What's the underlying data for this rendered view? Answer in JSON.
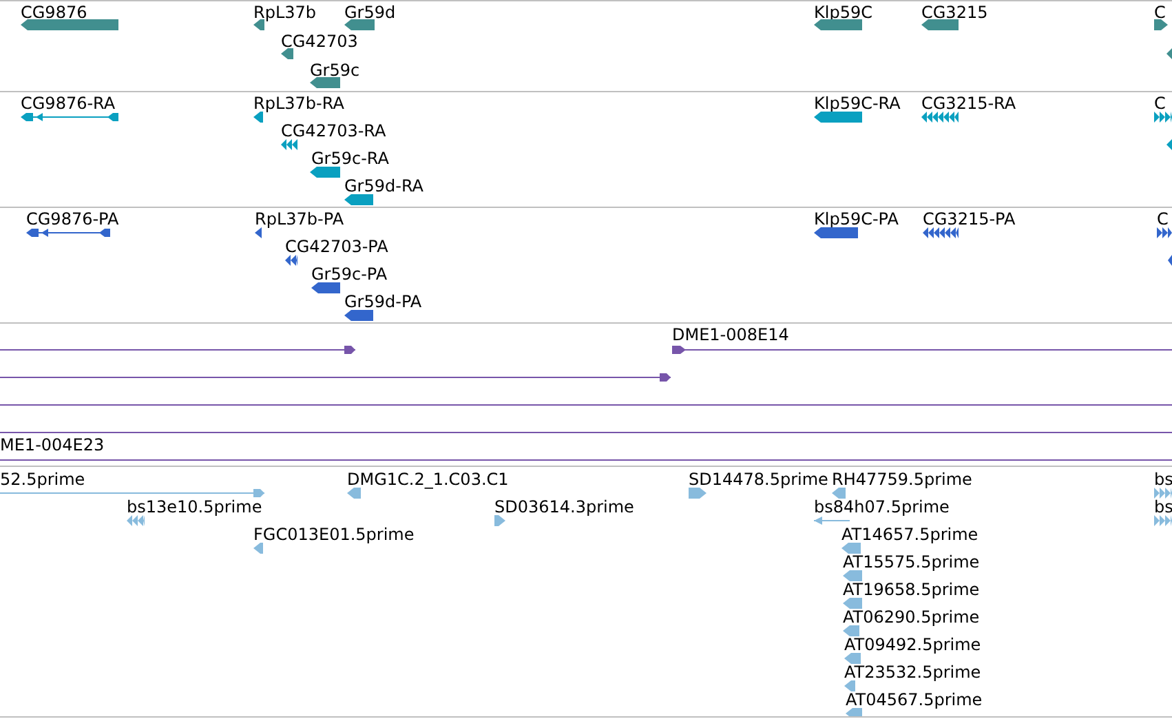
{
  "tracks": [
    {
      "color": "#418f8f",
      "features": [
        {
          "label": "CG9876",
          "reverse": true,
          "kind": "block"
        },
        {
          "label": "RpL37b",
          "reverse": true,
          "kind": "block"
        },
        {
          "label": "Gr59d",
          "reverse": true,
          "kind": "block"
        },
        {
          "label": "CG42703",
          "reverse": true,
          "kind": "block"
        },
        {
          "label": "Gr59c",
          "reverse": true,
          "kind": "block"
        },
        {
          "label": "Klp59C",
          "reverse": true,
          "kind": "block"
        },
        {
          "label": "CG3215",
          "reverse": true,
          "kind": "block"
        },
        {
          "label": "C",
          "reverse": false,
          "kind": "block"
        },
        {
          "reverse": true,
          "kind": "block"
        }
      ]
    },
    {
      "color": "#0aa0c0",
      "features": [
        {
          "label": "CG9876-RA",
          "reverse": true,
          "kind": "spliced"
        },
        {
          "label": "RpL37b-RA",
          "reverse": true,
          "kind": "block"
        },
        {
          "label": "CG42703-RA",
          "reverse": true,
          "kind": "multi"
        },
        {
          "label": "Gr59c-RA",
          "reverse": true,
          "kind": "block"
        },
        {
          "label": "Gr59d-RA",
          "reverse": true,
          "kind": "block"
        },
        {
          "label": "Klp59C-RA",
          "reverse": true,
          "kind": "block"
        },
        {
          "label": "CG3215-RA",
          "reverse": true,
          "kind": "multi"
        },
        {
          "label": "C",
          "reverse": false,
          "kind": "multi"
        },
        {
          "reverse": true,
          "kind": "block"
        }
      ]
    },
    {
      "color": "#3366cc",
      "features": [
        {
          "label": "CG9876-PA",
          "reverse": true,
          "kind": "spliced"
        },
        {
          "label": "RpL37b-PA",
          "reverse": true,
          "kind": "block"
        },
        {
          "label": "CG42703-PA",
          "reverse": true,
          "kind": "multi"
        },
        {
          "label": "Gr59c-PA",
          "reverse": true,
          "kind": "block"
        },
        {
          "label": "Gr59d-PA",
          "reverse": true,
          "kind": "block"
        },
        {
          "label": "Klp59C-PA",
          "reverse": true,
          "kind": "block"
        },
        {
          "label": "CG3215-PA",
          "reverse": true,
          "kind": "multi"
        },
        {
          "label": "C",
          "reverse": false,
          "kind": "multi"
        },
        {
          "reverse": true,
          "kind": "block"
        }
      ]
    },
    {
      "color": "#7755aa",
      "features": [
        {
          "reverse": false,
          "kind": "line"
        },
        {
          "label": "DME1-008E14",
          "reverse": false,
          "kind": "line"
        },
        {
          "reverse": false,
          "kind": "line"
        },
        {
          "kind": "line"
        },
        {
          "kind": "line"
        },
        {
          "label": "ME1-004E23",
          "kind": "line"
        }
      ]
    },
    {
      "color": "#88bbdd",
      "features": [
        {
          "label": "52.5prime",
          "reverse": false,
          "kind": "line"
        },
        {
          "label": "DMG1C.2_1.C03.C1",
          "reverse": true,
          "kind": "block"
        },
        {
          "label": "SD14478.5prime",
          "reverse": false,
          "kind": "block"
        },
        {
          "label": "RH47759.5prime",
          "reverse": true,
          "kind": "block"
        },
        {
          "label": "bs",
          "reverse": false,
          "kind": "multi"
        },
        {
          "label": "bs13e10.5prime",
          "reverse": true,
          "kind": "multi"
        },
        {
          "label": "SD03614.3prime",
          "reverse": false,
          "kind": "block"
        },
        {
          "label": "bs84h07.5prime",
          "reverse": true,
          "kind": "line"
        },
        {
          "label": "bs",
          "reverse": false,
          "kind": "multi"
        },
        {
          "label": "FGC013E01.5prime",
          "reverse": true,
          "kind": "block"
        },
        {
          "label": "AT14657.5prime",
          "reverse": true,
          "kind": "block"
        },
        {
          "label": "AT15575.5prime",
          "reverse": true,
          "kind": "block"
        },
        {
          "label": "AT19658.5prime",
          "reverse": true,
          "kind": "block"
        },
        {
          "label": "AT06290.5prime",
          "reverse": true,
          "kind": "block"
        },
        {
          "label": "AT09492.5prime",
          "reverse": true,
          "kind": "block"
        },
        {
          "label": "AT23532.5prime",
          "reverse": true,
          "kind": "block"
        },
        {
          "label": "AT04567.5prime",
          "reverse": true,
          "kind": "block"
        }
      ]
    }
  ]
}
